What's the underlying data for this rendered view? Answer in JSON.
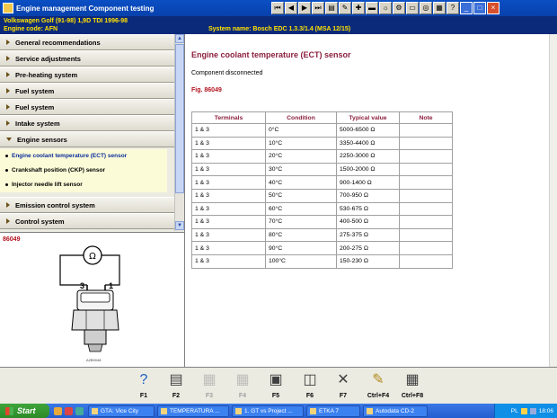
{
  "window": {
    "title": "Engine management Component testing"
  },
  "toolbar_top": [
    {
      "icon": "first-icon",
      "glyph": "⏮"
    },
    {
      "icon": "prev-icon",
      "glyph": "◀"
    },
    {
      "icon": "next-icon",
      "glyph": "▶"
    },
    {
      "icon": "last-icon",
      "glyph": "⏭"
    },
    {
      "icon": "book-icon",
      "glyph": "▤"
    },
    {
      "icon": "edit-icon",
      "glyph": "✎"
    },
    {
      "icon": "pin-icon",
      "glyph": "✚"
    },
    {
      "icon": "car-icon",
      "glyph": "▬"
    },
    {
      "icon": "bulb-icon",
      "glyph": "☼"
    },
    {
      "icon": "gear-icon",
      "glyph": "⚙"
    },
    {
      "icon": "battery-icon",
      "glyph": "▭"
    },
    {
      "icon": "tyre-icon",
      "glyph": "◎"
    },
    {
      "icon": "chart-icon",
      "glyph": "▦"
    },
    {
      "icon": "help-icon",
      "glyph": "?"
    }
  ],
  "window_controls": {
    "minimize": "_",
    "maximize": "□",
    "close": "×"
  },
  "vehicle": {
    "line1": "Volkswagen   Golf (91-98) 1,9D TDI 1996-98",
    "line2": "Engine code: AFN",
    "system": "System name: Bosch EDC 1.3.3/1.4 (MSA 12/15)"
  },
  "menu": [
    {
      "label": "General recommendations",
      "expanded": false
    },
    {
      "label": "Service adjustments",
      "expanded": false
    },
    {
      "label": "Pre-heating system",
      "expanded": false
    },
    {
      "label": "Fuel system",
      "expanded": false
    },
    {
      "label": "Fuel system",
      "expanded": false
    },
    {
      "label": "Intake system",
      "expanded": false
    },
    {
      "label": "Engine sensors",
      "expanded": true
    },
    {
      "label": "Emission control system",
      "expanded": false
    },
    {
      "label": "Control system",
      "expanded": false
    }
  ],
  "submenu": [
    {
      "label": "Engine coolant temperature (ECT) sensor",
      "selected": true
    },
    {
      "label": "Crankshaft position (CKP) sensor",
      "selected": false
    },
    {
      "label": "Injector needle lift sensor",
      "selected": false
    }
  ],
  "figure": {
    "label": "86049",
    "pin3": "3",
    "pin1": "1",
    "meter": "Ω",
    "ref": "A2B9048"
  },
  "main": {
    "title": "Engine coolant temperature (ECT) sensor",
    "status": "Component disconnected",
    "fig_ref": "Fig. 86049",
    "table": {
      "headers": [
        "Terminals",
        "Condition",
        "Typical value",
        "Note"
      ],
      "rows": [
        [
          "1 & 3",
          "0°C",
          "5000-6500 Ω",
          ""
        ],
        [
          "1 & 3",
          "10°C",
          "3350-4400 Ω",
          ""
        ],
        [
          "1 & 3",
          "20°C",
          "2250-3000 Ω",
          ""
        ],
        [
          "1 & 3",
          "30°C",
          "1500-2000 Ω",
          ""
        ],
        [
          "1 & 3",
          "40°C",
          "900-1400 Ω",
          ""
        ],
        [
          "1 & 3",
          "50°C",
          "700-950 Ω",
          ""
        ],
        [
          "1 & 3",
          "60°C",
          "530-675 Ω",
          ""
        ],
        [
          "1 & 3",
          "70°C",
          "400-500 Ω",
          ""
        ],
        [
          "1 & 3",
          "80°C",
          "275-375 Ω",
          ""
        ],
        [
          "1 & 3",
          "90°C",
          "200-275 Ω",
          ""
        ],
        [
          "1 & 3",
          "100°C",
          "150-230 Ω",
          ""
        ]
      ]
    }
  },
  "fkeys": [
    {
      "label": "F1",
      "icon": "help-icon",
      "glyph": "?",
      "enabled": true,
      "color": "#1c5fc2"
    },
    {
      "label": "F2",
      "icon": "printer-icon",
      "glyph": "▤",
      "enabled": true,
      "color": "#404040"
    },
    {
      "label": "F3",
      "icon": "diagram-icon",
      "glyph": "▦",
      "enabled": false,
      "color": "#a0a0a0"
    },
    {
      "label": "F4",
      "icon": "diagram-icon",
      "glyph": "▦",
      "enabled": false,
      "color": "#a0a0a0"
    },
    {
      "label": "F5",
      "icon": "document-icon",
      "glyph": "▣",
      "enabled": true,
      "color": "#404040"
    },
    {
      "label": "F6",
      "icon": "multimeter-icon",
      "glyph": "◫",
      "enabled": true,
      "color": "#404040"
    },
    {
      "label": "F7",
      "icon": "tools-icon",
      "glyph": "✕",
      "enabled": true,
      "color": "#404040"
    },
    {
      "label": "Ctrl+F4",
      "icon": "notes-icon",
      "glyph": "✎",
      "enabled": true,
      "color": "#b08a1a"
    },
    {
      "label": "Ctrl+F8",
      "icon": "calculator-icon",
      "glyph": "▦",
      "enabled": true,
      "color": "#404040"
    }
  ],
  "taskbar": {
    "start": "Start",
    "tasks": [
      "GTA: Vice City",
      "TEMPERATURA ...",
      "1. GT vs Project ...",
      "ETKA 7",
      "Autodata CD-2"
    ],
    "tray": {
      "lang": "PL",
      "time": "18:06"
    }
  }
}
